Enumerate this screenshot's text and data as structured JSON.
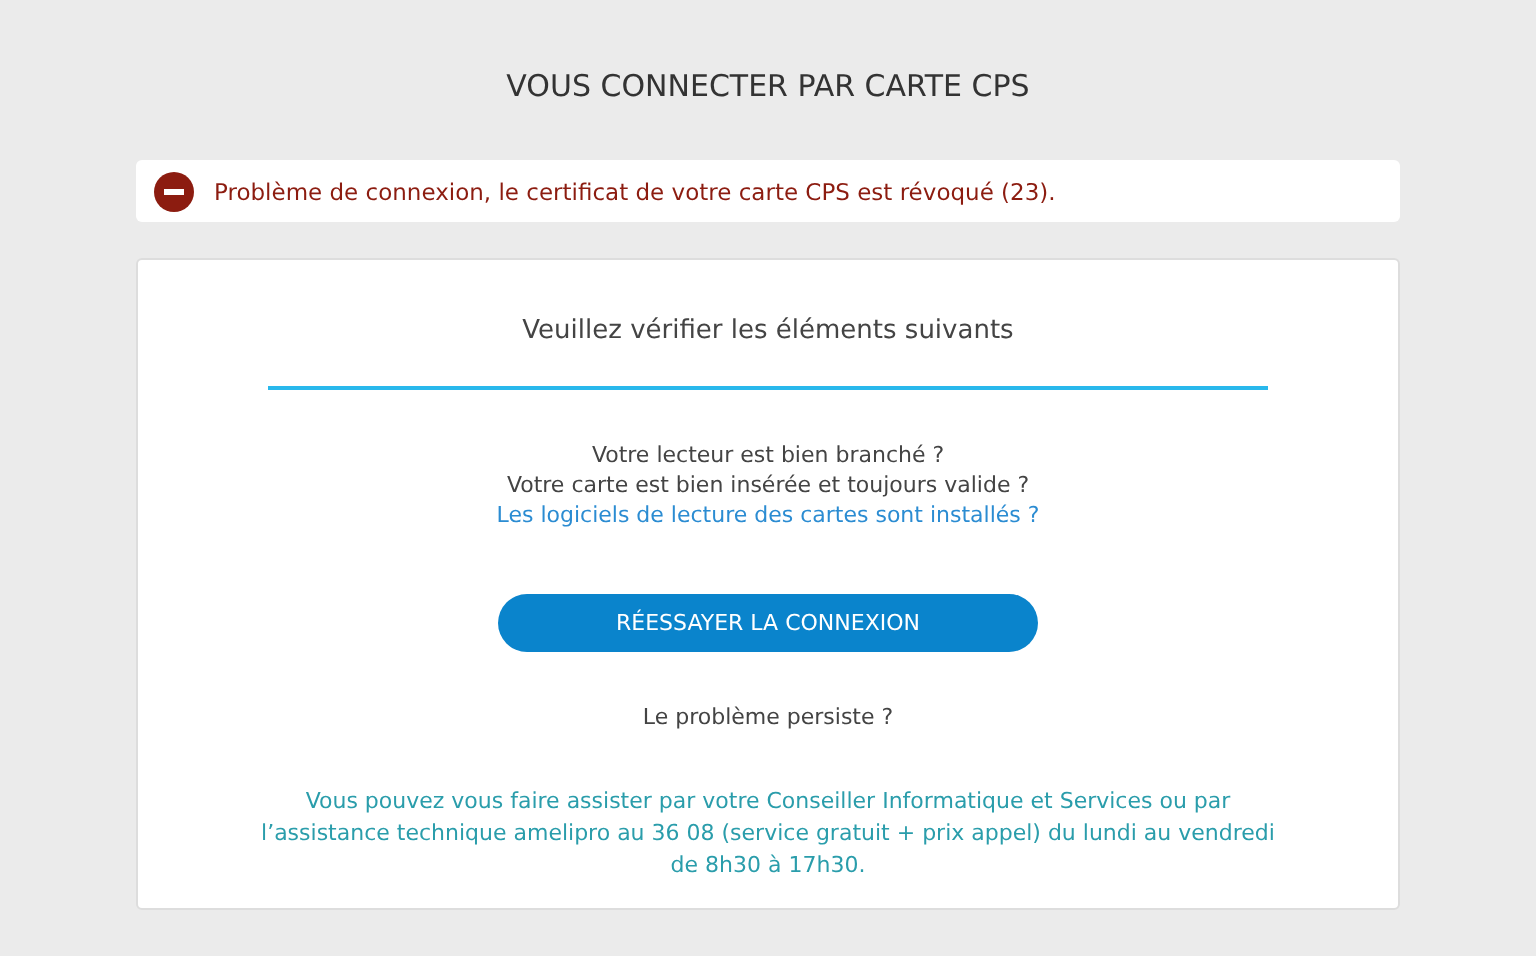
{
  "page_title": "VOUS CONNECTER PAR CARTE CPS",
  "alert": {
    "kind": "error",
    "message": "Problème de connexion, le certificat de votre carte CPS est révoqué (23)."
  },
  "card": {
    "heading": "Veuillez vérifier les éléments suivants",
    "checklist": [
      {
        "kind": "text",
        "text": "Votre lecteur est bien branché ?"
      },
      {
        "kind": "text",
        "text": "Votre carte est bien insérée et toujours valide ?"
      },
      {
        "kind": "link",
        "text": "Les logiciels de lecture des cartes sont installés ?"
      }
    ],
    "retry_button": "RÉESSAYER LA CONNEXION",
    "persist_question": "Le problème persiste ?",
    "help_text": "Vous pouvez vous faire assister par votre Conseiller Informatique et Services ou par l’assistance technique amelipro au 36 08 (service gratuit + prix appel) du lundi au vendredi de 8h30 à 17h30."
  }
}
